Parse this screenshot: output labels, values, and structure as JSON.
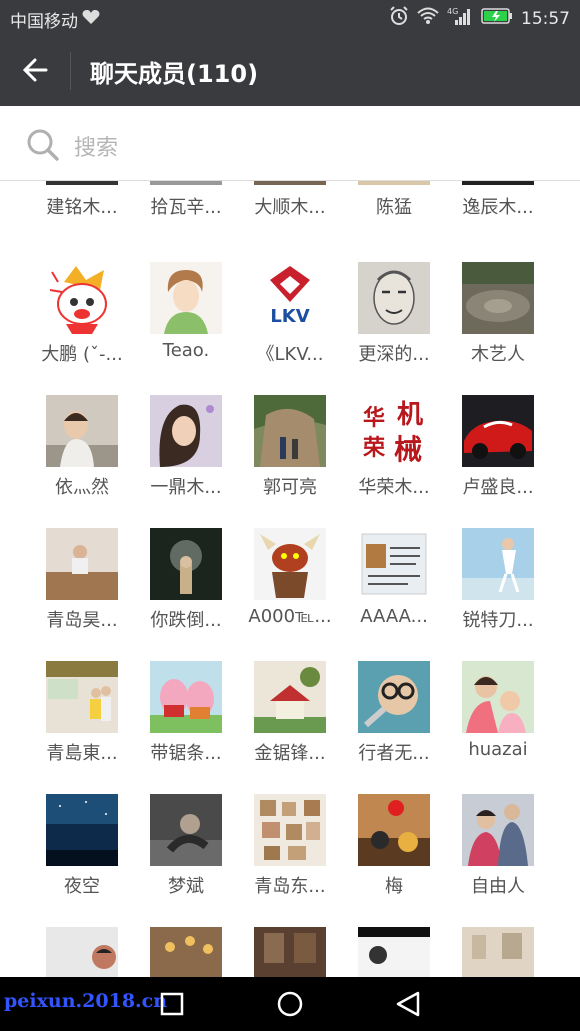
{
  "status_bar": {
    "carrier": "中国移动",
    "network": "4G",
    "time": "15:57"
  },
  "header": {
    "title": "聊天成员(110)"
  },
  "search": {
    "placeholder": "搜索"
  },
  "members_partial": [
    "建铭木...",
    "拾瓦辛...",
    "大顺木...",
    "陈猛",
    "逸辰木..."
  ],
  "members": [
    "大鹏 (ˇ-...",
    "Teao.",
    "《LKV...",
    "更深的...",
    "木艺人",
    "依灬然",
    "一鼎木...",
    "郭可亮",
    "华荣木...",
    "卢盛良...",
    "青岛昊...",
    "你跌倒...",
    "A000℡...",
    "AAAA...",
    "锐特刀...",
    "青島東...",
    "带锯条...",
    "金锯锋...",
    "行者无...",
    "huazai",
    "夜空",
    "梦斌",
    "青岛东...",
    "梅",
    "自由人"
  ],
  "avatar_logos": {
    "lkv": "LKV",
    "huarong": [
      "华",
      "机",
      "荣",
      "械"
    ]
  },
  "watermark": "peixun.2018.cn"
}
